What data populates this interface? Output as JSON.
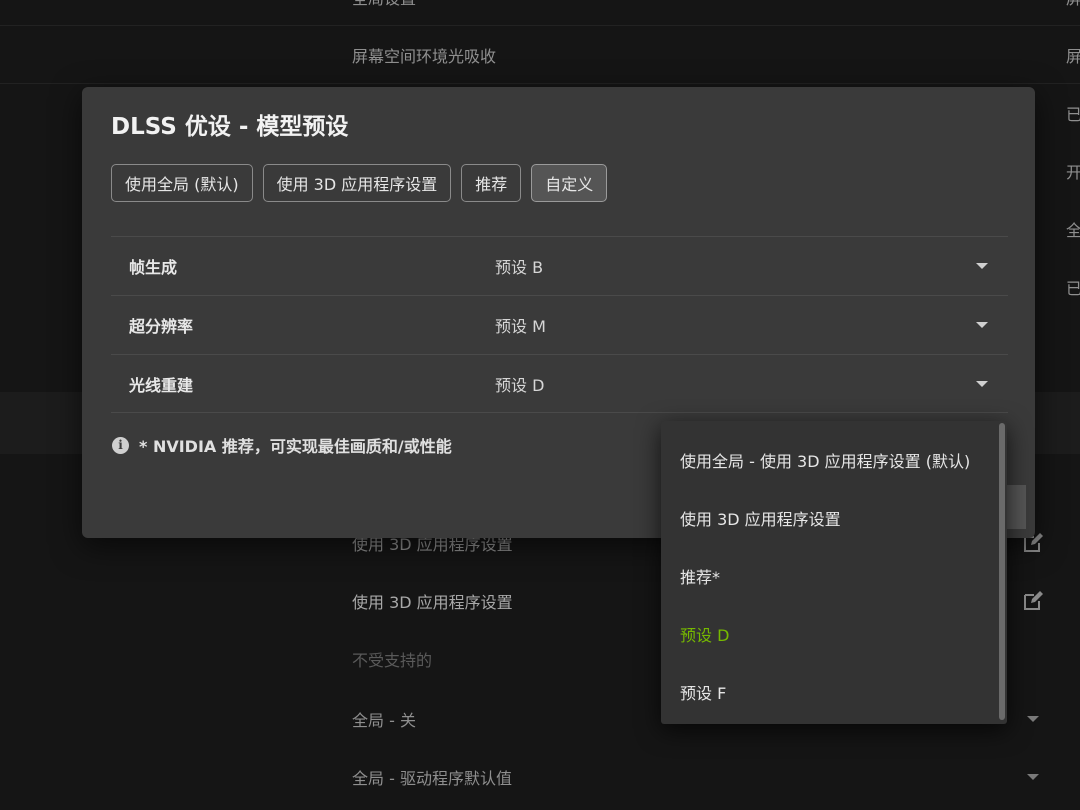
{
  "background": {
    "rows": [
      {
        "label": "全局设置",
        "value": "屏"
      },
      {
        "label": "屏幕空间环境光吸收",
        "value": "屏"
      },
      {
        "value": "已"
      },
      {
        "value": "开"
      },
      {
        "value": "全"
      },
      {
        "value": "已"
      },
      {
        "label": "使用 3D 应用程序设置"
      },
      {
        "label": "使用 3D 应用程序设置"
      },
      {
        "label": "不受支持的"
      },
      {
        "label": "全局 - 关"
      },
      {
        "label": "全局 - 驱动程序默认值"
      }
    ]
  },
  "modal": {
    "title": "DLSS 优设 - 模型预设",
    "mode_buttons": [
      {
        "label": "使用全局 (默认)",
        "active": false
      },
      {
        "label": "使用 3D 应用程序设置",
        "active": false
      },
      {
        "label": "推荐",
        "active": false
      },
      {
        "label": "自定义",
        "active": true
      }
    ],
    "settings": [
      {
        "name": "帧生成",
        "value": "预设 B"
      },
      {
        "name": "超分辨率",
        "value": "预设 M"
      },
      {
        "name": "光线重建",
        "value": "预设 D"
      }
    ],
    "footnote": "* NVIDIA 推荐，可实现最佳画质和/或性能",
    "info_icon": "info-icon"
  },
  "dropdown": {
    "options": [
      {
        "label": "使用全局 - 使用 3D 应用程序设置 (默认)",
        "selected": false
      },
      {
        "label": "使用 3D 应用程序设置",
        "selected": false
      },
      {
        "label": "推荐*",
        "selected": false
      },
      {
        "label": "预设 D",
        "selected": true
      },
      {
        "label": "预设 F",
        "selected": false
      }
    ],
    "selected_color": "#76b900"
  }
}
